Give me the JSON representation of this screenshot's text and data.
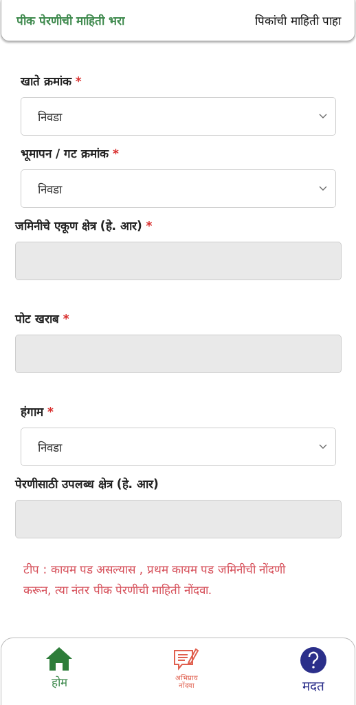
{
  "tabs": [
    {
      "label": "पीक पेरणीची माहिती भरा",
      "selected": true
    },
    {
      "label": "पिकांची माहिती पाहा",
      "selected": false
    }
  ],
  "fields": [
    {
      "kind": "select",
      "label": "खाते क्रमांक",
      "required": true,
      "value": "निवडा"
    },
    {
      "kind": "select",
      "label": "भूमापन / गट क्रमांक",
      "required": true,
      "value": "निवडा"
    },
    {
      "kind": "text",
      "label": "जमिनीचे एकूण क्षेत्र (हे. आर)",
      "required": true,
      "disabled": true
    },
    {
      "kind": "text",
      "label": "पोट खराब",
      "required": true,
      "disabled": true
    },
    {
      "kind": "select",
      "label": "हंगाम",
      "required": true,
      "value": "निवडा"
    },
    {
      "kind": "text",
      "label": "पेरणीसाठी उपलब्ध क्षेत्र (हे. आर)",
      "required": false,
      "disabled": true
    }
  ],
  "required_mark": "*",
  "note": "टीप : कायम पड असल्यास , प्रथम कायम पड जमिनीची नोंदणी करून, त्या नंतर पीक पेरणीची माहिती नोंदवा.",
  "bottom_nav": [
    {
      "kind": "home",
      "label": "होम",
      "selected": true
    },
    {
      "kind": "feedback",
      "label": "अभिप्राय नोंदवा",
      "selected": false
    },
    {
      "kind": "help",
      "label": "मदत",
      "selected": false
    }
  ]
}
